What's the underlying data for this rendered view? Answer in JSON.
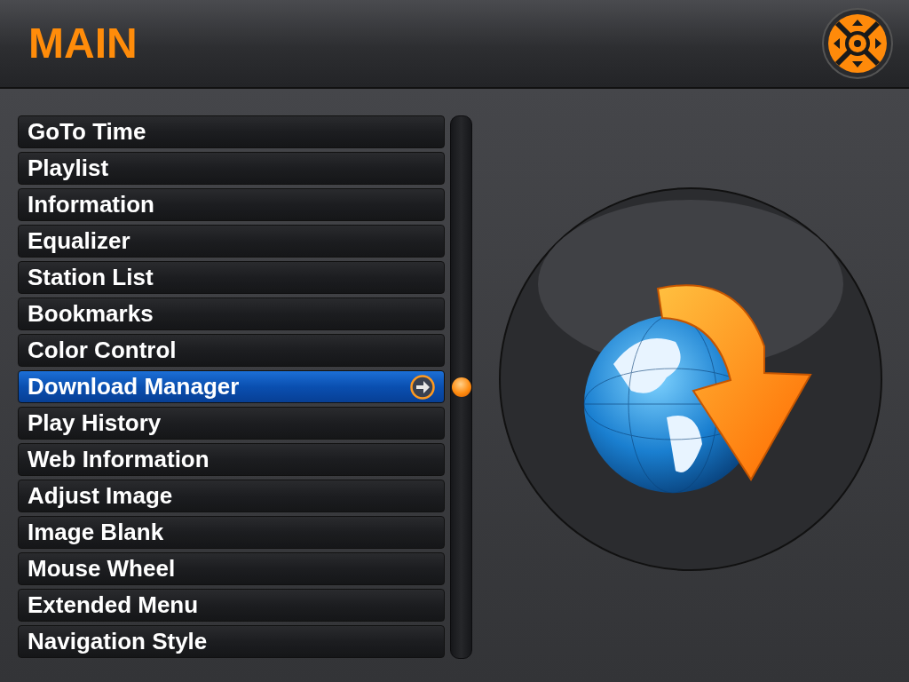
{
  "header": {
    "title": "MAIN"
  },
  "menu": [
    {
      "label": "GoTo Time",
      "selected": false
    },
    {
      "label": "Playlist",
      "selected": false
    },
    {
      "label": "Information",
      "selected": false
    },
    {
      "label": "Equalizer",
      "selected": false
    },
    {
      "label": "Station List",
      "selected": false
    },
    {
      "label": "Bookmarks",
      "selected": false
    },
    {
      "label": "Color Control",
      "selected": false
    },
    {
      "label": "Download Manager",
      "selected": true
    },
    {
      "label": "Play History",
      "selected": false
    },
    {
      "label": "Web Information",
      "selected": false
    },
    {
      "label": "Adjust Image",
      "selected": false
    },
    {
      "label": "Image Blank",
      "selected": false
    },
    {
      "label": "Mouse Wheel",
      "selected": false
    },
    {
      "label": "Extended Menu",
      "selected": false
    },
    {
      "label": "Navigation Style",
      "selected": false
    }
  ]
}
